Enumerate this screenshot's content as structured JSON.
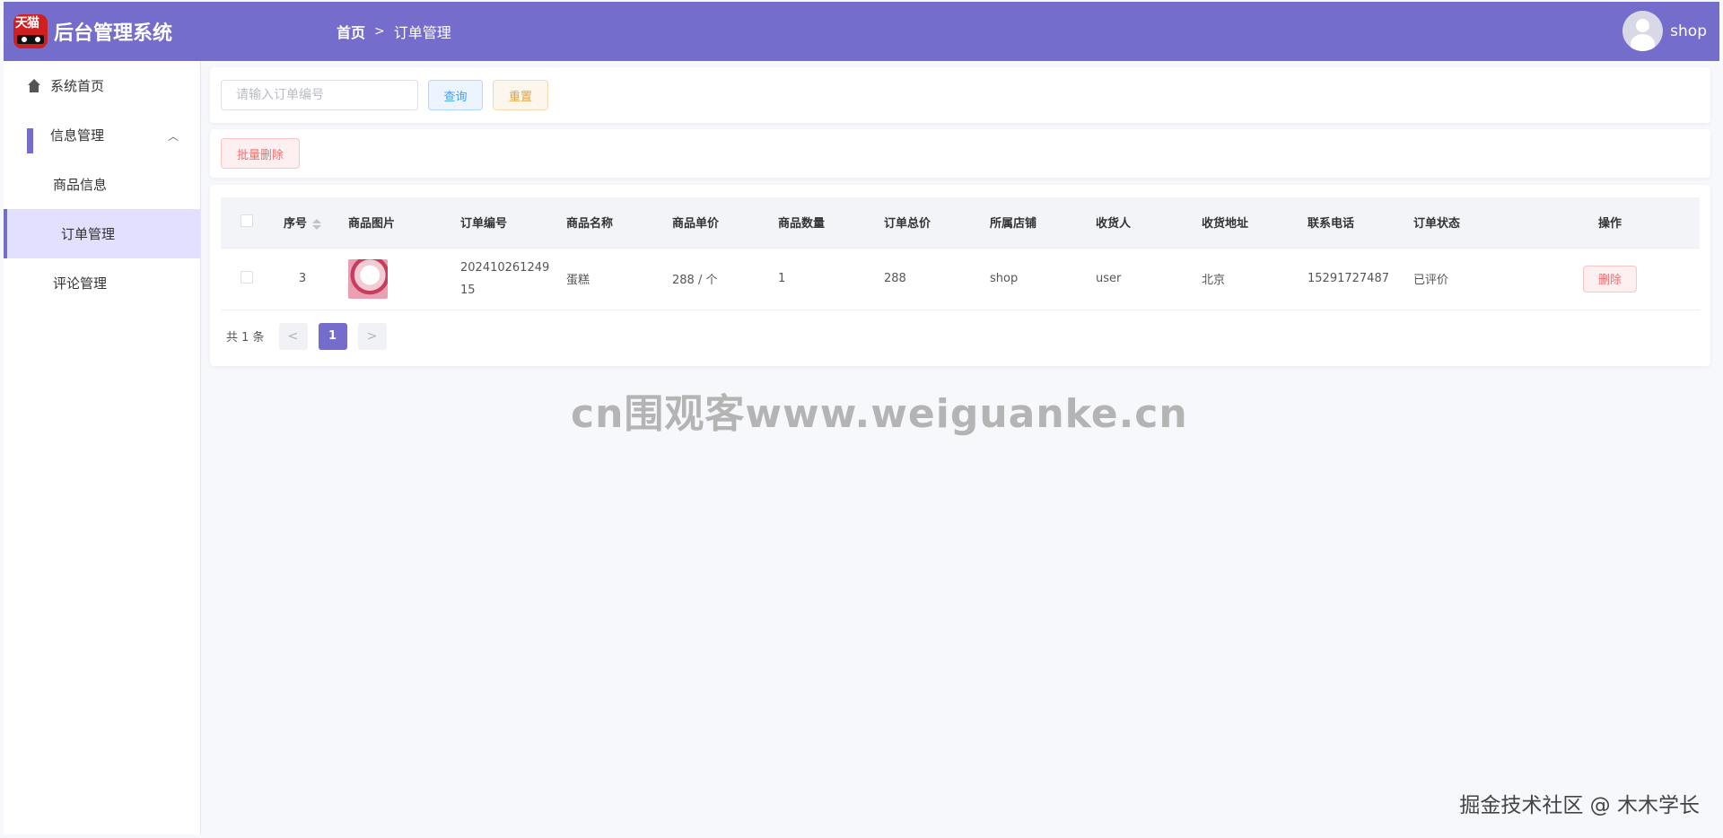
{
  "header": {
    "logo_text": "天猫",
    "app_title": "后台管理系统",
    "breadcrumb": {
      "home": "首页",
      "separator": ">",
      "current": "订单管理"
    },
    "user": {
      "name": "shop"
    },
    "colors": {
      "primary": "#746dcb"
    }
  },
  "sidebar": {
    "items": [
      {
        "label": "系统首页",
        "icon": "home-icon"
      },
      {
        "label": "信息管理",
        "icon": "grid-icon",
        "expanded": true
      },
      {
        "label": "商品信息"
      },
      {
        "label": "订单管理",
        "active": true
      },
      {
        "label": "评论管理"
      }
    ]
  },
  "search": {
    "placeholder": "请输入订单编号",
    "value": "",
    "query_label": "查询",
    "reset_label": "重置"
  },
  "actions": {
    "batch_delete_label": "批量删除"
  },
  "table": {
    "columns": [
      "序号",
      "商品图片",
      "订单编号",
      "商品名称",
      "商品单价",
      "商品数量",
      "订单总价",
      "所属店铺",
      "收货人",
      "收货地址",
      "联系电话",
      "订单状态",
      "操作"
    ],
    "rows": [
      {
        "index": "3",
        "order_no_line1": "202410261249",
        "order_no_line2": "15",
        "product_name": "蛋糕",
        "unit_price": "288 / 个",
        "quantity": "1",
        "total": "288",
        "shop": "shop",
        "receiver": "user",
        "address": "北京",
        "phone": "15291727487",
        "status": "已评价",
        "delete_label": "删除"
      }
    ]
  },
  "pagination": {
    "total_text": "共 1 条",
    "prev": "<",
    "current_page": "1",
    "next": ">"
  },
  "watermarks": {
    "center": "cn围观客www.weiguanke.cn",
    "corner": "掘金技术社区 @ 木木学长"
  }
}
